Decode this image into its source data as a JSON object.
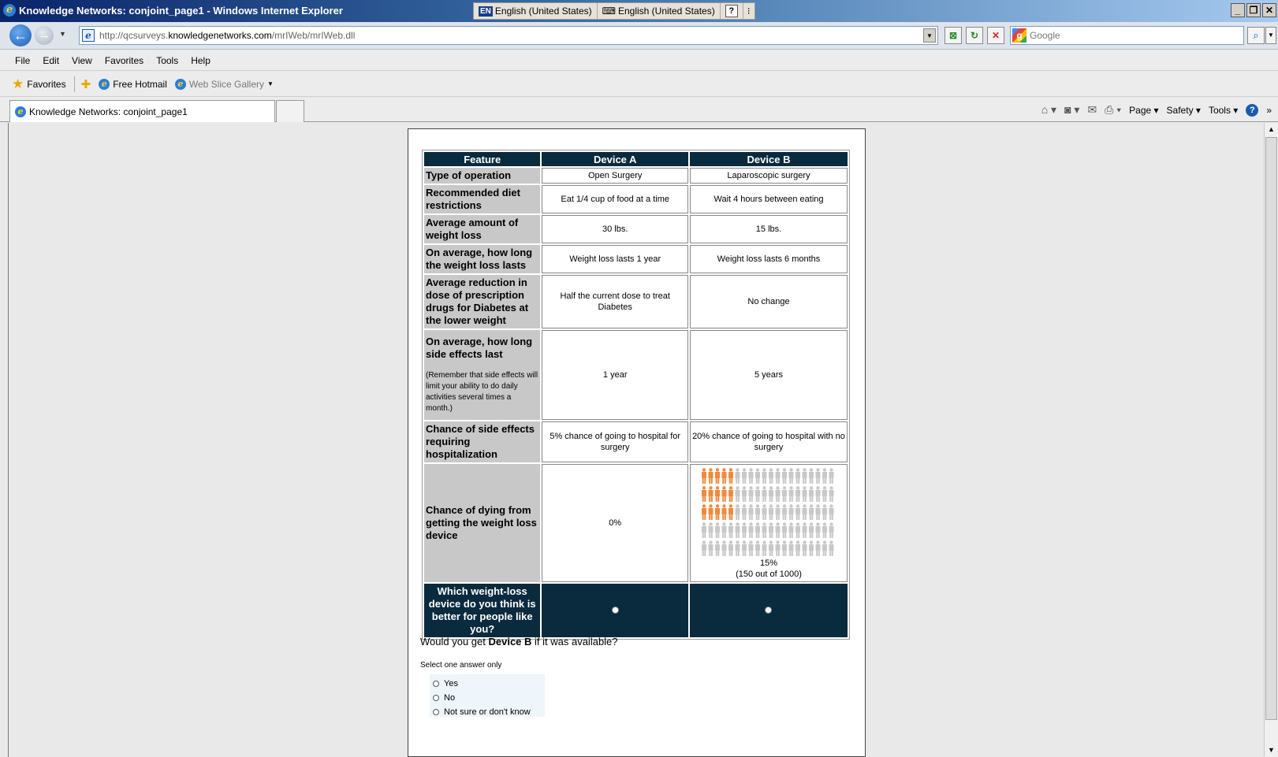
{
  "window": {
    "title": "Knowledge Networks: conjoint_page1 - Windows Internet Explorer",
    "lang1": "English (United States)",
    "lang2": "English (United States)",
    "lang_badge": "EN"
  },
  "address": {
    "url_prefix": "http://qcsurveys.",
    "url_domain": "knowledgenetworks.com",
    "url_suffix": "/mrIWeb/mrIWeb.dll",
    "search_placeholder": "Google"
  },
  "menu": [
    "File",
    "Edit",
    "View",
    "Favorites",
    "Tools",
    "Help"
  ],
  "favorites": {
    "favorites_label": "Favorites",
    "free_hotmail": "Free Hotmail",
    "web_slice": "Web Slice Gallery"
  },
  "tab": {
    "title": "Knowledge Networks: conjoint_page1"
  },
  "cmdbar": {
    "page": "Page",
    "safety": "Safety",
    "tools": "Tools"
  },
  "table": {
    "headers": [
      "Feature",
      "Device A",
      "Device B"
    ],
    "rows": [
      {
        "feature": "Type of operation",
        "a": "Open Surgery",
        "b": "Laparoscopic surgery"
      },
      {
        "feature": "Recommended diet restrictions",
        "a": "Eat 1/4 cup of food at a time",
        "b": "Wait 4 hours between eating"
      },
      {
        "feature": "Average amount of weight loss",
        "a": "30 lbs.",
        "b": "15 lbs."
      },
      {
        "feature": "On average, how long the weight loss lasts",
        "a": "Weight loss lasts 1 year",
        "b": "Weight loss lasts 6 months"
      },
      {
        "feature": "Average reduction in dose of prescription drugs for Diabetes at the lower weight",
        "a": "Half the current dose to treat Diabetes",
        "b": "No change"
      },
      {
        "feature": "On average, how long side effects last",
        "note": "(Remember that side effects will limit your ability to do daily activities several times a month.)",
        "a": "1 year",
        "b": "5 years"
      },
      {
        "feature": "Chance of side effects requiring hospitalization",
        "a": "5% chance of going to hospital for surgery",
        "b": "20% chance of going to hospital with no surgery"
      },
      {
        "feature": "Chance of dying from getting the weight loss device",
        "a": "0%",
        "b_pct": "15%",
        "b_detail": "(150 out of 1000)"
      }
    ],
    "question": "Which weight-loss device do you think is better for people like you?"
  },
  "pictograph": {
    "rows": 5,
    "cols": 20,
    "highlighted_per_row": [
      5,
      5,
      5,
      0,
      0
    ],
    "highlight_color": "#f08a3c",
    "base_color": "#c8c8c8"
  },
  "followup": {
    "prefix": "Would you get ",
    "device": "Device B",
    "suffix": " if it was available?",
    "select_note": "Select one answer only",
    "options": [
      "Yes",
      "No",
      "Not sure or don't know"
    ]
  }
}
